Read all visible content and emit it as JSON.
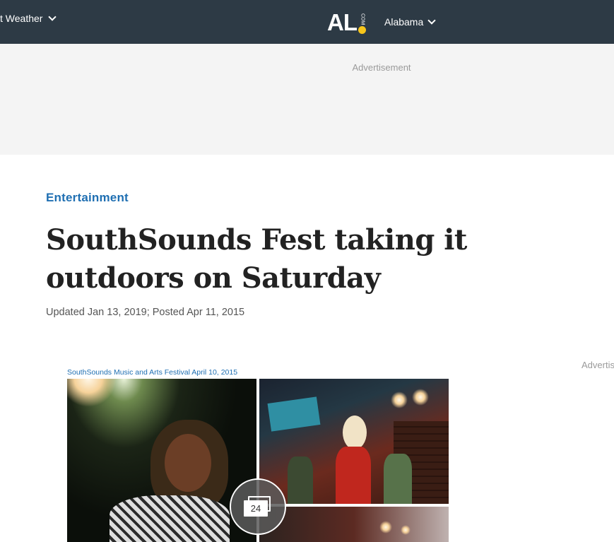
{
  "header": {
    "weather_label": "t Weather",
    "logo_text": "AL",
    "logo_com": "COM",
    "region_label": "Alabama"
  },
  "ad": {
    "top_label": "Advertisement",
    "side_label": "Advertis"
  },
  "article": {
    "section": "Entertainment",
    "title": "SouthSounds Fest taking it outdoors on Saturday",
    "dateline": "Updated Jan 13, 2019; Posted Apr 11, 2015"
  },
  "gallery": {
    "caption": "SouthSounds Music and Arts Festival April 10, 2015",
    "photo_count": "24"
  },
  "colors": {
    "nav_bg": "#2d3a45",
    "accent": "#1f6fb2",
    "logo_dot": "#f6c51b"
  },
  "icons": [
    "chevron-down-icon",
    "gallery-stack-icon"
  ]
}
